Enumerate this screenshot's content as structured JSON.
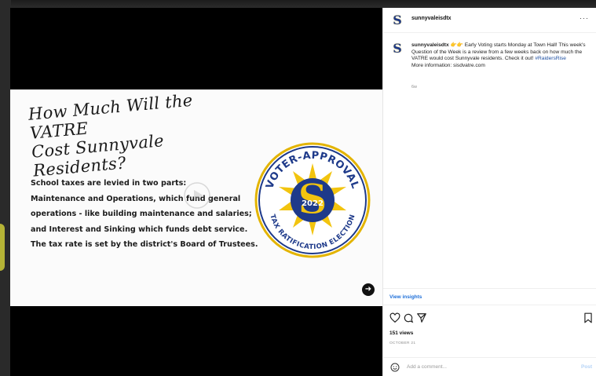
{
  "media": {
    "slide": {
      "title_line1": "How Much Will the VATRE",
      "title_line2": "Cost Sunnyvale Residents?",
      "body_lines": [
        "School taxes are levied in two parts:",
        "Maintenance and Operations, which fund general",
        "operations - like building maintenance and salaries;",
        "and Interest and Sinking which funds debt service.",
        "The tax rate is set by the district's Board of Trustees."
      ],
      "seal": {
        "top_text": "VOTER-APPROVAL",
        "bottom_text": "TAX RATIFICATION ELECTION",
        "letter": "S",
        "year": "2022"
      },
      "icons": {
        "play": "play-icon",
        "next": "arrow-right-icon"
      }
    }
  },
  "post": {
    "username": "sunnyvaleisdtx",
    "more_icon": "···",
    "logo_letter": "S",
    "caption": {
      "username": "sunnyvaleisdtx",
      "emoji": "👉👉",
      "text": "Early Voting starts Monday at Town Hall! This week's Question of the Week is a review from a few weeks back on how much the VATRE would cost Sunnyvale residents. Check it out!",
      "hashtag": "#RaidersRise",
      "more_info": "More information: sisdvatre.com"
    },
    "age": "6w",
    "insights_label": "View insights",
    "views": "151 views",
    "date": "OCTOBER 21",
    "comment_placeholder": "Add a comment...",
    "post_label": "Post",
    "icons": [
      "heart-icon",
      "comment-icon",
      "share-icon",
      "bookmark-icon",
      "emoji-icon"
    ]
  },
  "colors": {
    "brand_navy": "#1e3a8a",
    "brand_gold": "#f2c40f",
    "link_blue": "#1e6fd9"
  }
}
